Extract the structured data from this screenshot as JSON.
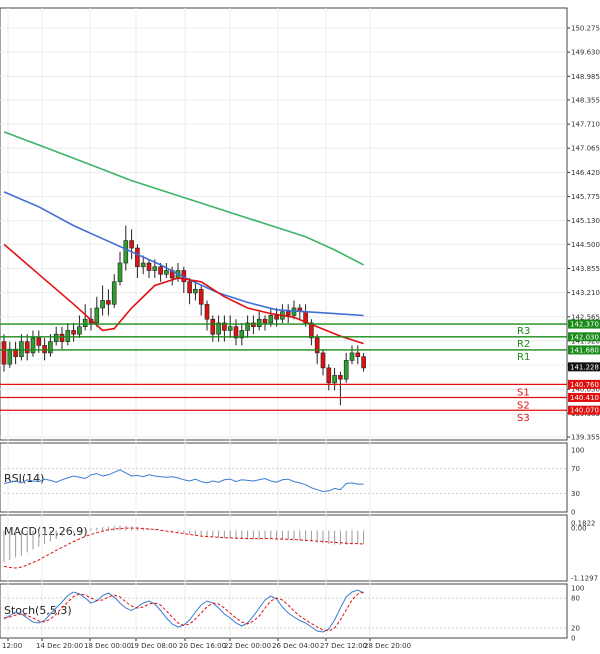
{
  "chart_data": {
    "type": "candlestick",
    "price_ticks": [
      "150.275",
      "149.630",
      "148.985",
      "148.355",
      "147.710",
      "147.065",
      "146.420",
      "145.775",
      "145.130",
      "144.500",
      "143.855",
      "143.210",
      "142.565",
      "141.920",
      "141.275",
      "140.630",
      "139.985",
      "139.355"
    ],
    "x_ticks": [
      "12:00",
      "14 Dec 20:00",
      "18 Dec 00:00",
      "19 Dec 08:00",
      "20 Dec 16:00",
      "22 Dec 00:00",
      "26 Dec 04:00",
      "27 Dec 12:00",
      "28 Dec 20:00"
    ],
    "current_price": "141.228",
    "levels": {
      "resistance": [
        {
          "name": "R1",
          "value": "141.680",
          "color": "#1a8a1a"
        },
        {
          "name": "R2",
          "value": "142.030",
          "color": "#1a8a1a"
        },
        {
          "name": "R3",
          "value": "142.370",
          "color": "#1a8a1a"
        }
      ],
      "support": [
        {
          "name": "S1",
          "value": "140.760",
          "color": "#e01010"
        },
        {
          "name": "S2",
          "value": "140.410",
          "color": "#e01010"
        },
        {
          "name": "S3",
          "value": "140.070",
          "color": "#e01010"
        }
      ]
    },
    "candles": [
      [
        141.9,
        141.3,
        142.1,
        141.1
      ],
      [
        141.3,
        141.7,
        141.9,
        141.2
      ],
      [
        141.7,
        141.5,
        141.9,
        141.3
      ],
      [
        141.5,
        141.9,
        142.1,
        141.4
      ],
      [
        141.9,
        141.6,
        142.1,
        141.4
      ],
      [
        141.6,
        142.0,
        142.2,
        141.5
      ],
      [
        142.0,
        141.8,
        142.2,
        141.6
      ],
      [
        141.8,
        141.6,
        142.0,
        141.4
      ],
      [
        141.6,
        141.9,
        142.1,
        141.5
      ],
      [
        141.9,
        142.1,
        142.3,
        141.8
      ],
      [
        142.1,
        141.9,
        142.3,
        141.7
      ],
      [
        141.9,
        142.2,
        142.4,
        141.8
      ],
      [
        142.2,
        142.1,
        142.4,
        141.9
      ],
      [
        142.1,
        142.3,
        142.6,
        142.0
      ],
      [
        142.3,
        142.5,
        142.9,
        142.2
      ],
      [
        142.5,
        142.4,
        142.8,
        142.2
      ],
      [
        142.4,
        142.8,
        143.1,
        142.3
      ],
      [
        142.8,
        143.0,
        143.4,
        142.6
      ],
      [
        143.0,
        142.9,
        143.3,
        142.6
      ],
      [
        142.9,
        143.5,
        143.7,
        142.8
      ],
      [
        143.5,
        144.0,
        144.3,
        143.4
      ],
      [
        144.0,
        144.6,
        145.0,
        143.8
      ],
      [
        144.6,
        144.4,
        144.9,
        144.1
      ],
      [
        144.4,
        143.9,
        144.5,
        143.6
      ],
      [
        143.9,
        144.0,
        144.2,
        143.7
      ],
      [
        144.0,
        143.8,
        144.1,
        143.6
      ],
      [
        143.8,
        143.9,
        144.1,
        143.6
      ],
      [
        143.9,
        143.7,
        144.0,
        143.5
      ],
      [
        143.7,
        143.8,
        144.0,
        143.6
      ],
      [
        143.8,
        143.6,
        143.9,
        143.4
      ],
      [
        143.6,
        143.8,
        144.0,
        143.5
      ],
      [
        143.8,
        143.5,
        143.9,
        143.2
      ],
      [
        143.5,
        143.2,
        143.6,
        142.9
      ],
      [
        143.2,
        143.3,
        143.5,
        143.0
      ],
      [
        143.3,
        142.9,
        143.4,
        142.6
      ],
      [
        142.9,
        142.5,
        143.0,
        142.2
      ],
      [
        142.5,
        142.1,
        142.6,
        141.9
      ],
      [
        142.1,
        142.4,
        142.6,
        141.9
      ],
      [
        142.4,
        142.2,
        142.6,
        141.9
      ],
      [
        142.2,
        142.3,
        142.6,
        142.0
      ],
      [
        142.3,
        142.0,
        142.5,
        141.8
      ],
      [
        142.0,
        142.2,
        142.4,
        141.8
      ],
      [
        142.2,
        142.4,
        142.6,
        142.0
      ],
      [
        142.4,
        142.3,
        142.6,
        142.1
      ],
      [
        142.3,
        142.5,
        142.7,
        142.2
      ],
      [
        142.5,
        142.4,
        142.6,
        142.2
      ],
      [
        142.4,
        142.6,
        142.8,
        142.3
      ],
      [
        142.6,
        142.5,
        142.8,
        142.3
      ],
      [
        142.5,
        142.7,
        142.9,
        142.4
      ],
      [
        142.7,
        142.6,
        142.9,
        142.4
      ],
      [
        142.6,
        142.8,
        143.0,
        142.5
      ],
      [
        142.8,
        142.7,
        142.9,
        142.5
      ],
      [
        142.7,
        142.4,
        142.9,
        142.3
      ],
      [
        142.4,
        142.0,
        142.5,
        141.8
      ],
      [
        142.0,
        141.6,
        142.1,
        141.3
      ],
      [
        141.6,
        141.2,
        141.7,
        141.0
      ],
      [
        141.2,
        140.8,
        141.3,
        140.6
      ],
      [
        140.8,
        141.0,
        141.2,
        140.6
      ],
      [
        141.0,
        140.9,
        141.1,
        140.2
      ],
      [
        140.9,
        141.4,
        141.6,
        140.8
      ],
      [
        141.4,
        141.6,
        141.8,
        141.3
      ],
      [
        141.6,
        141.5,
        141.8,
        141.3
      ],
      [
        141.5,
        141.2,
        141.6,
        141.1
      ]
    ],
    "ma_red": [
      [
        0,
        144.5
      ],
      [
        6,
        143.7
      ],
      [
        12,
        142.9
      ],
      [
        17,
        142.2
      ],
      [
        19,
        142.25
      ],
      [
        22,
        142.8
      ],
      [
        26,
        143.4
      ],
      [
        30,
        143.6
      ],
      [
        34,
        143.5
      ],
      [
        38,
        143.1
      ],
      [
        42,
        142.8
      ],
      [
        46,
        142.65
      ],
      [
        50,
        142.55
      ],
      [
        54,
        142.3
      ],
      [
        58,
        142.05
      ],
      [
        62,
        141.85
      ]
    ],
    "ma_blue": [
      [
        0,
        145.9
      ],
      [
        6,
        145.5
      ],
      [
        12,
        145.0
      ],
      [
        17,
        144.65
      ],
      [
        22,
        144.3
      ],
      [
        27,
        143.95
      ],
      [
        32,
        143.55
      ],
      [
        37,
        143.2
      ],
      [
        42,
        142.95
      ],
      [
        47,
        142.75
      ],
      [
        52,
        142.7
      ],
      [
        57,
        142.65
      ],
      [
        62,
        142.6
      ]
    ],
    "ma_green": [
      [
        0,
        147.5
      ],
      [
        6,
        147.15
      ],
      [
        12,
        146.8
      ],
      [
        17,
        146.5
      ],
      [
        22,
        146.2
      ],
      [
        27,
        145.95
      ],
      [
        32,
        145.7
      ],
      [
        37,
        145.45
      ],
      [
        42,
        145.2
      ],
      [
        47,
        144.95
      ],
      [
        52,
        144.7
      ],
      [
        57,
        144.35
      ],
      [
        62,
        143.95
      ]
    ],
    "rsi": {
      "label": "RSI(14)",
      "ticks": [
        "100",
        "70",
        "30",
        "0"
      ],
      "values": [
        46,
        48,
        50,
        47,
        52,
        50,
        49,
        53,
        51,
        48,
        52,
        55,
        58,
        56,
        54,
        60,
        62,
        58,
        60,
        64,
        68,
        63,
        58,
        59,
        57,
        60,
        58,
        57,
        56,
        57,
        55,
        52,
        50,
        53,
        49,
        47,
        50,
        48,
        52,
        53,
        49,
        52,
        51,
        50,
        52,
        54,
        50,
        48,
        52,
        53,
        49,
        47,
        44,
        39,
        36,
        33,
        34,
        38,
        36,
        46,
        47,
        45,
        45
      ]
    },
    "macd": {
      "label": "MACD(12,26,9)",
      "ticks": [
        "0.1822",
        "0.00",
        "-1.1297"
      ],
      "hist": [
        -0.75,
        -0.7,
        -0.64,
        -0.6,
        -0.52,
        -0.45,
        -0.38,
        -0.32,
        -0.25,
        -0.2,
        -0.14,
        -0.1,
        -0.06,
        -0.02,
        0.02,
        0.05,
        0.07,
        0.09,
        0.1,
        0.11,
        0.12,
        0.11,
        0.1,
        0.09,
        0.07,
        0.05,
        0.03,
        0.01,
        -0.01,
        -0.02,
        -0.04,
        -0.06,
        -0.08,
        -0.1,
        -0.12,
        -0.14,
        -0.16,
        -0.17,
        -0.18,
        -0.19,
        -0.19,
        -0.2,
        -0.2,
        -0.21,
        -0.21,
        -0.2,
        -0.2,
        -0.21,
        -0.22,
        -0.22,
        -0.23,
        -0.24,
        -0.25,
        -0.26,
        -0.28,
        -0.3,
        -0.32,
        -0.33,
        -0.34,
        -0.34,
        -0.33,
        -0.32,
        -0.31
      ],
      "signal": [
        -0.85,
        -0.88,
        -0.89,
        -0.87,
        -0.82,
        -0.76,
        -0.7,
        -0.62,
        -0.55,
        -0.47,
        -0.4,
        -0.33,
        -0.26,
        -0.2,
        -0.14,
        -0.09,
        -0.05,
        -0.01,
        0.02,
        0.04,
        0.05,
        0.06,
        0.06,
        0.06,
        0.05,
        0.04,
        0.03,
        0.01,
        -0.01,
        -0.03,
        -0.05,
        -0.07,
        -0.09,
        -0.11,
        -0.13,
        -0.14,
        -0.15,
        -0.16,
        -0.17,
        -0.17,
        -0.18,
        -0.18,
        -0.19,
        -0.19,
        -0.19,
        -0.19,
        -0.19,
        -0.2,
        -0.2,
        -0.21,
        -0.21,
        -0.22,
        -0.23,
        -0.24,
        -0.25,
        -0.26,
        -0.27,
        -0.28,
        -0.29,
        -0.3,
        -0.31,
        -0.31,
        -0.32
      ]
    },
    "stoch": {
      "label": "Stoch(5,5,3)",
      "ticks": [
        "100",
        "80",
        "20",
        "0"
      ],
      "k": [
        38,
        45,
        52,
        48,
        40,
        32,
        30,
        35,
        48,
        60,
        72,
        85,
        92,
        88,
        80,
        70,
        74,
        85,
        90,
        82,
        70,
        60,
        55,
        62,
        70,
        74,
        68,
        55,
        40,
        28,
        22,
        26,
        36,
        52,
        66,
        74,
        70,
        60,
        48,
        40,
        30,
        24,
        30,
        44,
        60,
        76,
        84,
        78,
        62,
        50,
        42,
        35,
        30,
        22,
        14,
        12,
        18,
        36,
        60,
        82,
        92,
        96,
        90
      ],
      "d": [
        40,
        42,
        46,
        48,
        45,
        40,
        34,
        32,
        38,
        48,
        60,
        72,
        83,
        88,
        86,
        80,
        75,
        76,
        82,
        86,
        82,
        72,
        64,
        60,
        62,
        68,
        70,
        66,
        54,
        42,
        30,
        25,
        28,
        38,
        50,
        62,
        70,
        68,
        60,
        50,
        40,
        32,
        28,
        34,
        44,
        60,
        74,
        80,
        76,
        66,
        54,
        44,
        36,
        29,
        22,
        16,
        14,
        20,
        36,
        56,
        76,
        88,
        92
      ]
    }
  }
}
